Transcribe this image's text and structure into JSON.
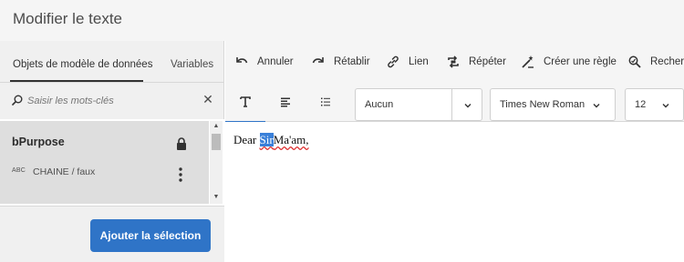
{
  "window": {
    "title": "Modifier le texte"
  },
  "left_panel": {
    "tabs": [
      {
        "label": "Objets de modèle de données",
        "active": true
      },
      {
        "label": "Variables",
        "active": false
      }
    ],
    "search": {
      "placeholder": "Saisir les mots-clés",
      "value": ""
    },
    "items": [
      {
        "name": "bPurpose",
        "type_badge": "ABC",
        "type_label": "CHAINE / faux",
        "locked": true
      }
    ],
    "add_button_label": "Ajouter la sélection"
  },
  "toolbar": {
    "undo": "Annuler",
    "redo": "Rétablir",
    "link": "Lien",
    "repeat": "Répéter",
    "create_rule": "Créer une règle",
    "search": "Recher"
  },
  "format": {
    "tabs": [
      "text-icon",
      "paragraph-icon",
      "list-icon"
    ],
    "style_value": "Aucun",
    "font_value": "Times New Roman",
    "size_value": "12"
  },
  "editor": {
    "text_before": "Dear ",
    "text_selected": "Sir",
    "text_after": "Ma'am,"
  },
  "colors": {
    "accent": "#2f74c7",
    "selection": "#3a80d9",
    "spell_underline": "#dd3333"
  }
}
